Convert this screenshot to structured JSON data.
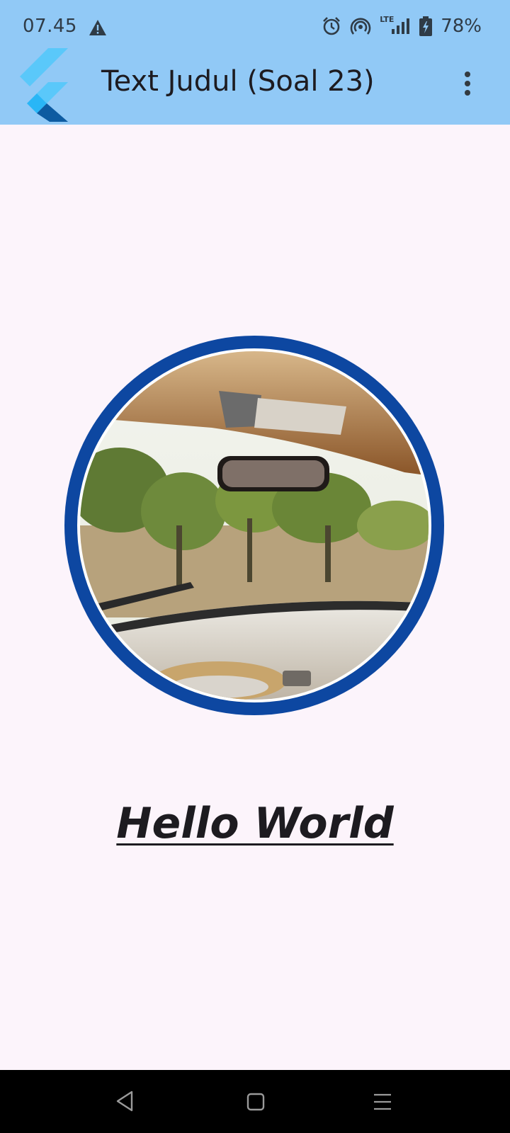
{
  "status_bar": {
    "time": "07.45",
    "warning_icon": "warning-icon",
    "alarm_icon": "alarm-icon",
    "hotspot_icon": "hotspot-icon",
    "network_label": "LTE",
    "signal_icon": "signal-icon",
    "battery_icon": "battery-charging-icon",
    "battery_percent": "78%"
  },
  "app_bar": {
    "logo": "flutter-logo",
    "title": "Text Judul (Soal 23)",
    "menu_icon": "more-vert-icon",
    "background": "#91c9f6"
  },
  "content": {
    "avatar_border_color": "#0d47a1",
    "image_subject": "car interior with rear-view mirror and trees through windshield",
    "greeting": "Hello World"
  },
  "nav_bar": {
    "back_icon": "back-icon",
    "home_icon": "home-icon",
    "recents_icon": "recents-icon"
  }
}
